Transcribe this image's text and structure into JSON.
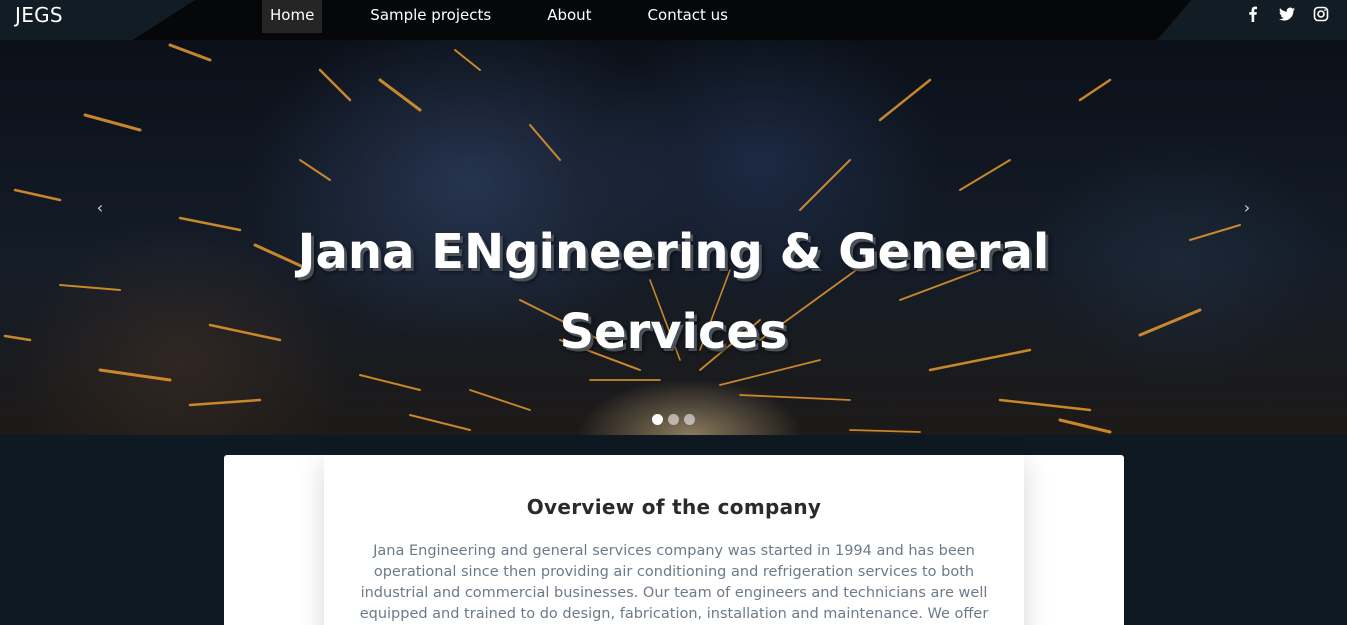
{
  "nav": {
    "brand": "JEGS",
    "links": [
      {
        "label": "Home"
      },
      {
        "label": "Sample projects"
      },
      {
        "label": "About"
      },
      {
        "label": "Contact us"
      }
    ],
    "social_icons": [
      "facebook-icon",
      "twitter-icon",
      "instagram-icon"
    ]
  },
  "hero": {
    "title": "Jana ENgineering & General Services",
    "prev_glyph": "‹",
    "next_glyph": "›",
    "slide_count": 3,
    "active_slide": 1
  },
  "overview": {
    "title": "Overview of the company",
    "text": "Jana Engineering and general services company was started in 1994 and has been operational since then providing air conditioning and refrigeration services to both industrial and commercial businesses. Our team of engineers and technicians are well equipped and trained to do design, fabrication, installation and maintenance. We offer training to"
  },
  "colors": {
    "page_bg": "#0f1922",
    "navbar_bg": "#050708",
    "spark": "#e89a2c",
    "text_muted": "#6c7a89"
  }
}
